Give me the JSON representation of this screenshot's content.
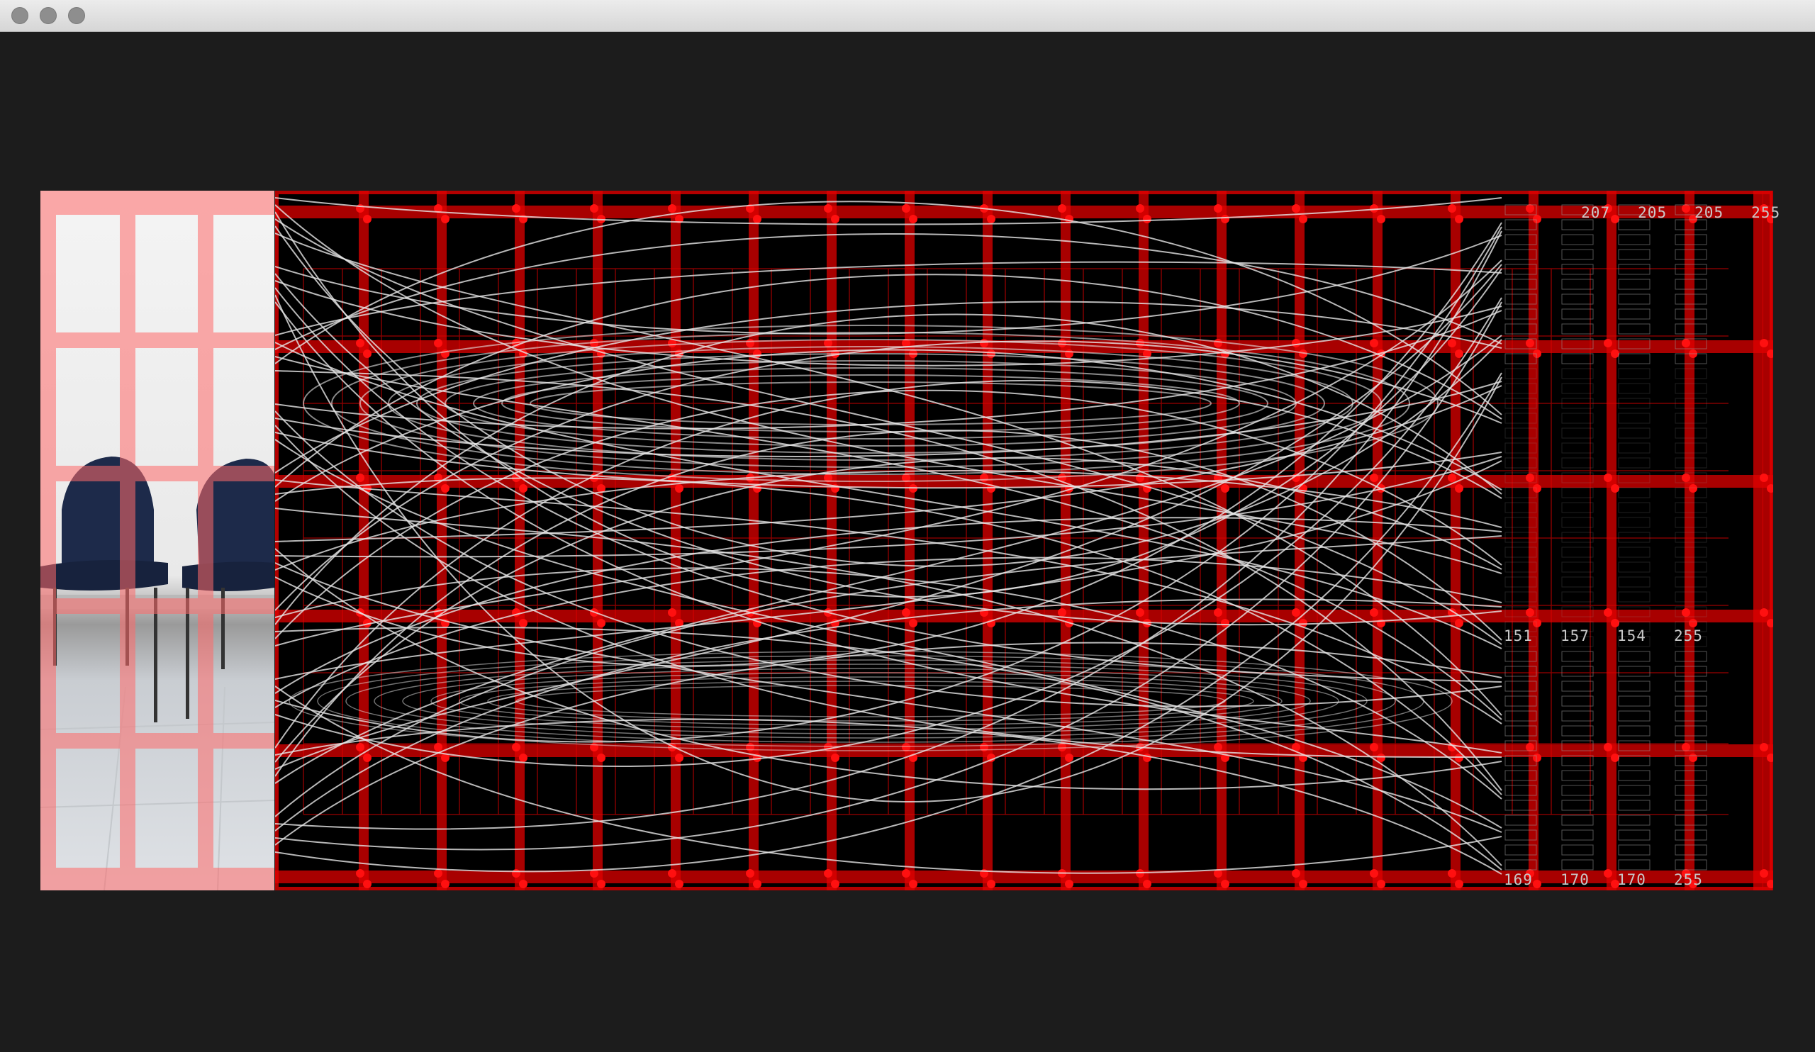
{
  "window": {
    "buttons": [
      "close",
      "minimize",
      "zoom"
    ]
  },
  "viewer": {
    "image_description_icon": "chairs-photo",
    "colors": {
      "grid": "#e00000",
      "curves": "#e6e6e6",
      "background": "#000000",
      "frame": "#1c1c1c"
    },
    "value_table": {
      "first_row": [
        "207",
        "205",
        "205",
        "255"
      ],
      "mid_row": [
        "151",
        "157",
        "154",
        "255"
      ],
      "last_row": [
        "169",
        "170",
        "170",
        "255"
      ]
    }
  }
}
